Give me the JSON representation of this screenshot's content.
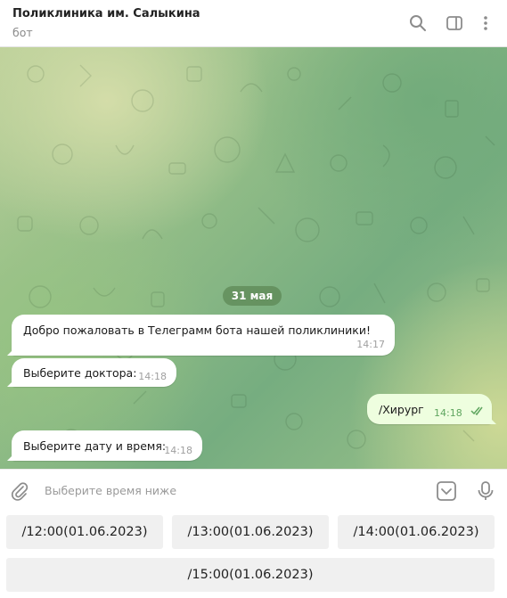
{
  "header": {
    "title": "Поликлиника им. Салыкина",
    "subtitle": "бот"
  },
  "chat": {
    "date_label": "31 мая",
    "messages": [
      {
        "direction": "in",
        "text": "Добро пожаловать в Телеграмм бота нашей поликлиники!",
        "time": "14:17"
      },
      {
        "direction": "in",
        "text": "Выберите доктора:",
        "time": "14:18"
      },
      {
        "direction": "out",
        "text": "/Хирург",
        "time": "14:18",
        "status": "read"
      },
      {
        "direction": "in",
        "text": "Выберите дату и время:",
        "time": "14:18"
      }
    ]
  },
  "composer": {
    "placeholder": "Выберите время ниже"
  },
  "keyboard": {
    "buttons": [
      "/12:00(01.06.2023)",
      "/13:00(01.06.2023)",
      "/14:00(01.06.2023)",
      "/15:00(01.06.2023)"
    ]
  },
  "icons": {
    "header": [
      "search-icon",
      "sidebar-toggle-icon",
      "more-vertical-icon"
    ],
    "composer": [
      "attach-icon",
      "keyboard-toggle-icon",
      "microphone-icon"
    ],
    "read_receipt": "double-check-icon"
  },
  "colors": {
    "accent": "#5fa55f",
    "outgoing_bubble": "#eefedf",
    "incoming_bubble": "#ffffff"
  }
}
